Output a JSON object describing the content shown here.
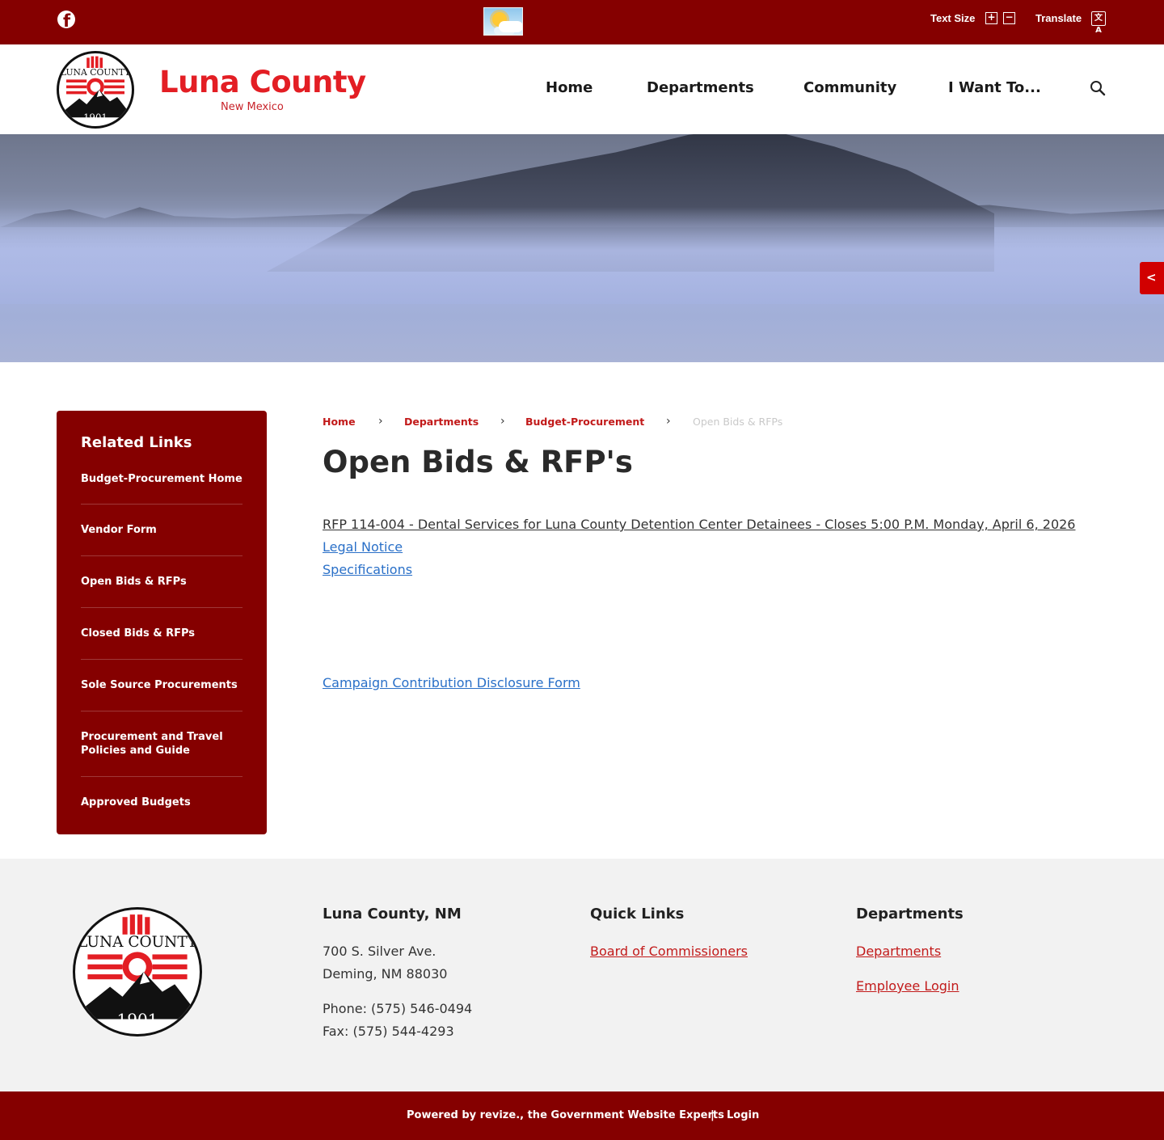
{
  "topbar": {
    "facebook_icon": "facebook-icon",
    "weather_icon": "sun-cloud-icon",
    "text_size_label": "Text Size",
    "increase_glyph": "+",
    "decrease_glyph": "−",
    "translate_label": "Translate",
    "translate_glyph": "文A",
    "background_color": "#850000"
  },
  "header": {
    "site_title": "Luna County",
    "site_subtitle": "New Mexico",
    "title_color": "#e31e24",
    "nav": [
      {
        "label": "Home"
      },
      {
        "label": "Departments"
      },
      {
        "label": "Community"
      },
      {
        "label": "I Want To..."
      }
    ],
    "search_icon": "search-icon"
  },
  "seal": {
    "top_text": "LUNA COUNTY",
    "year": "1901"
  },
  "hero": {
    "share_icon": "share-icon",
    "share_glyph": "<"
  },
  "sidebar": {
    "title": "Related Links",
    "links": [
      {
        "label": "Budget-Procurement Home"
      },
      {
        "label": "Vendor Form"
      },
      {
        "label": "Open Bids & RFPs"
      },
      {
        "label": "Closed Bids & RFPs"
      },
      {
        "label": "Sole Source Procurements"
      },
      {
        "label": "Procurement and Travel Policies and Guide"
      },
      {
        "label": "Approved Budgets"
      }
    ]
  },
  "breadcrumb": {
    "items": [
      "Home",
      "Departments",
      "Budget-Procurement",
      "Open Bids & RFPs"
    ],
    "separator": "›"
  },
  "main": {
    "title": "Open Bids & RFP's",
    "rfp_title": "RFP 114-004 - Dental Services for Luna County Detention Center Detainees - Closes 5:00 P.M. Monday, April 6, 2026",
    "legal_notice": "Legal Notice",
    "specifications": "Specifications",
    "campaign_form": "Campaign Contribution Disclosure Form"
  },
  "footer": {
    "contact": {
      "heading": "Luna County, NM",
      "address_line1": "700 S. Silver Ave.",
      "address_line2": "Deming, NM 88030",
      "phone": "Phone: (575) 546-0494",
      "fax": "Fax: (575) 544-4293"
    },
    "quick_links": {
      "heading": "Quick Links",
      "links": [
        "Board of Commissioners"
      ]
    },
    "departments": {
      "heading": "Departments",
      "links": [
        "Departments",
        "Employee Login"
      ]
    }
  },
  "bottombar": {
    "powered_by": "Powered by revize., the Government Website Experts",
    "separator": "|",
    "login": "Login"
  }
}
